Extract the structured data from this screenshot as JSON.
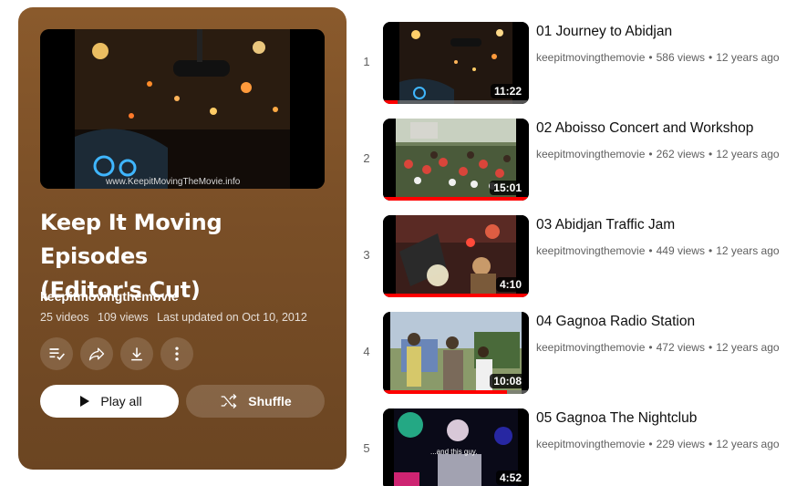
{
  "playlist": {
    "title_line1": "Keep It Moving Episodes",
    "title_line2": "(Editor's Cut)",
    "channel": "keepitmovingthemovie",
    "video_count": "25 videos",
    "views": "109 views",
    "last_updated": "Last updated on Oct 10, 2012",
    "thumbnail_watermark": "www.KeepitMovingTheMovie.info",
    "play_all_label": "Play all",
    "shuffle_label": "Shuffle",
    "accent_color": "#7a4f27"
  },
  "icons": {
    "save": "playlist-add-icon",
    "share": "share-icon",
    "download": "download-icon",
    "more": "more-vert-icon",
    "play": "play-icon",
    "shuffle": "shuffle-icon"
  },
  "videos": [
    {
      "index": "1",
      "title": "01 Journey to Abidjan",
      "channel": "keepitmovingthemovie",
      "views": "586 views",
      "age": "12 years ago",
      "duration": "11:22",
      "progress": 0.1,
      "overlay_text": ""
    },
    {
      "index": "2",
      "title": "02 Aboisso Concert and Workshop",
      "channel": "keepitmovingthemovie",
      "views": "262 views",
      "age": "12 years ago",
      "duration": "15:01",
      "progress": 1.0,
      "overlay_text": ""
    },
    {
      "index": "3",
      "title": "03 Abidjan Traffic Jam",
      "channel": "keepitmovingthemovie",
      "views": "449 views",
      "age": "12 years ago",
      "duration": "4:10",
      "progress": 1.0,
      "overlay_text": ""
    },
    {
      "index": "4",
      "title": "04 Gagnoa Radio Station",
      "channel": "keepitmovingthemovie",
      "views": "472 views",
      "age": "12 years ago",
      "duration": "10:08",
      "progress": 0.85,
      "overlay_text": ""
    },
    {
      "index": "5",
      "title": "05 Gagnoa The Nightclub",
      "channel": "keepitmovingthemovie",
      "views": "229 views",
      "age": "12 years ago",
      "duration": "4:52",
      "progress": 0,
      "overlay_text": "...and this guy."
    }
  ]
}
